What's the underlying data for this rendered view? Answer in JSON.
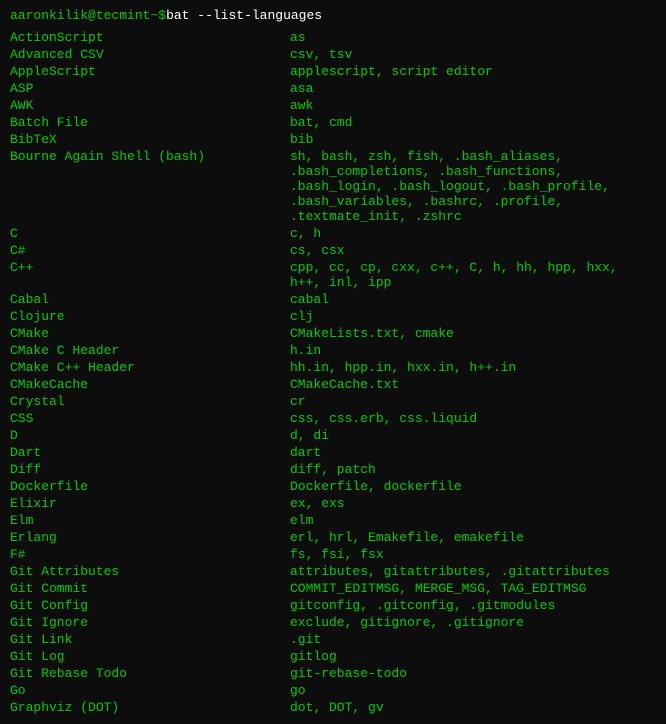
{
  "terminal": {
    "prompt": {
      "user": "aaronkilik",
      "at": "@",
      "host": "tecmint",
      "path": " ~ ",
      "dollar": "$ ",
      "command": "bat --list-languages"
    },
    "languages": [
      {
        "name": "ActionScript",
        "extensions": "as"
      },
      {
        "name": "Advanced CSV",
        "extensions": "csv, tsv"
      },
      {
        "name": "AppleScript",
        "extensions": "applescript, script editor"
      },
      {
        "name": "ASP",
        "extensions": "asa"
      },
      {
        "name": "AWK",
        "extensions": "awk"
      },
      {
        "name": "Batch File",
        "extensions": "bat, cmd"
      },
      {
        "name": "BibTeX",
        "extensions": "bib"
      },
      {
        "name": "Bourne Again Shell (bash)",
        "extensions": "sh, bash, zsh, fish, .bash_aliases,\n.bash_completions, .bash_functions,\n.bash_login, .bash_logout, .bash_profile,\n.bash_variables, .bashrc, .profile,\n.textmate_init, .zshrc"
      },
      {
        "name": "C",
        "extensions": "c, h"
      },
      {
        "name": "C#",
        "extensions": "cs, csx"
      },
      {
        "name": "C++",
        "extensions": "cpp, cc, cp, cxx, c++, C, h, hh, hpp, hxx,\nh++, inl, ipp"
      },
      {
        "name": "Cabal",
        "extensions": "cabal"
      },
      {
        "name": "Clojure",
        "extensions": "clj"
      },
      {
        "name": "CMake",
        "extensions": "CMakeLists.txt, cmake"
      },
      {
        "name": "CMake C Header",
        "extensions": "h.in"
      },
      {
        "name": "CMake C++ Header",
        "extensions": "hh.in, hpp.in, hxx.in, h++.in"
      },
      {
        "name": "CMakeCache",
        "extensions": "CMakeCache.txt"
      },
      {
        "name": "Crystal",
        "extensions": "cr"
      },
      {
        "name": "CSS",
        "extensions": "css, css.erb, css.liquid"
      },
      {
        "name": "D",
        "extensions": "d, di"
      },
      {
        "name": "Dart",
        "extensions": "dart"
      },
      {
        "name": "Diff",
        "extensions": "diff, patch"
      },
      {
        "name": "Dockerfile",
        "extensions": "Dockerfile, dockerfile"
      },
      {
        "name": "Elixir",
        "extensions": "ex, exs"
      },
      {
        "name": "Elm",
        "extensions": "elm"
      },
      {
        "name": "Erlang",
        "extensions": "erl, hrl, Emakefile, emakefile"
      },
      {
        "name": "F#",
        "extensions": "fs, fsi, fsx"
      },
      {
        "name": "Git Attributes",
        "extensions": "attributes, gitattributes, .gitattributes"
      },
      {
        "name": "Git Commit",
        "extensions": "COMMIT_EDITMSG, MERGE_MSG, TAG_EDITMSG"
      },
      {
        "name": "Git Config",
        "extensions": "gitconfig, .gitconfig, .gitmodules"
      },
      {
        "name": "Git Ignore",
        "extensions": "exclude, gitignore, .gitignore"
      },
      {
        "name": "Git Link",
        "extensions": ".git"
      },
      {
        "name": "Git Log",
        "extensions": "gitlog"
      },
      {
        "name": "Git Rebase Todo",
        "extensions": "git-rebase-todo"
      },
      {
        "name": "Go",
        "extensions": "go"
      },
      {
        "name": "Graphviz (DOT)",
        "extensions": "dot, DOT, gv"
      }
    ]
  }
}
